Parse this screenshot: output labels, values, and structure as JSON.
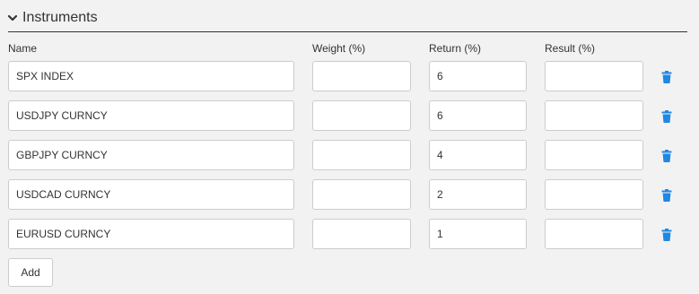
{
  "section": {
    "title": "Instruments",
    "icon": "chevron-down-icon"
  },
  "columns": {
    "name": "Name",
    "weight": "Weight (%)",
    "return": "Return (%)",
    "result": "Result (%)"
  },
  "rows": [
    {
      "name": "SPX INDEX",
      "weight": "",
      "return": "6",
      "result": ""
    },
    {
      "name": "USDJPY CURNCY",
      "weight": "",
      "return": "6",
      "result": ""
    },
    {
      "name": "GBPJPY CURNCY",
      "weight": "",
      "return": "4",
      "result": ""
    },
    {
      "name": "USDCAD CURNCY",
      "weight": "",
      "return": "2",
      "result": ""
    },
    {
      "name": "EURUSD CURNCY",
      "weight": "",
      "return": "1",
      "result": ""
    }
  ],
  "add_label": "Add",
  "colors": {
    "accent": "#1e88e5",
    "text": "#333333",
    "border": "#cccccc",
    "background": "#f2f2f2"
  }
}
